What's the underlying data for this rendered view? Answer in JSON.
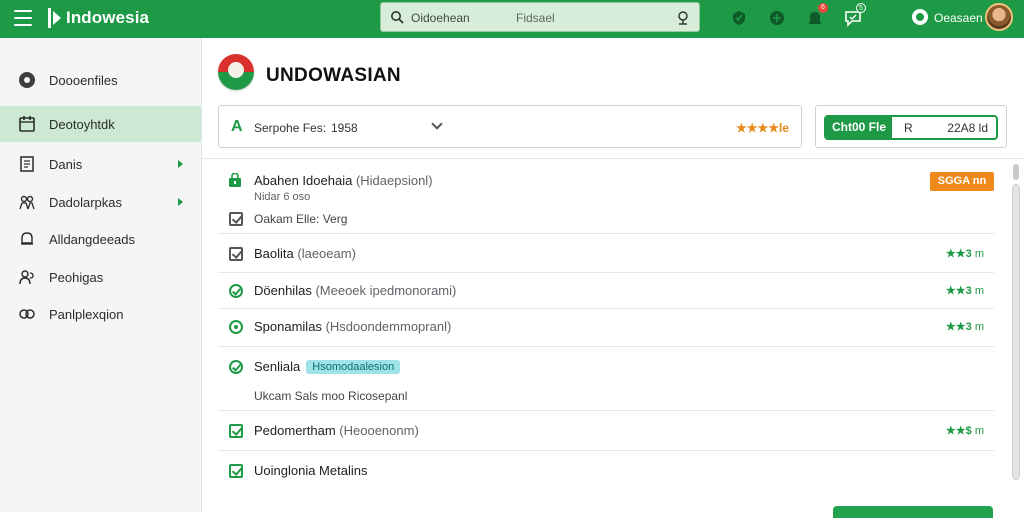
{
  "app": {
    "title": "Indowesia",
    "brand_color": "#1e9a46"
  },
  "topbar": {
    "search_placeholder": "Oidoehean",
    "search_scope": "Fidsael",
    "icons": [
      "menu-icon",
      "search-icon",
      "mic-icon",
      "shield-icon",
      "chat-icon",
      "bell-icon",
      "message-icon"
    ],
    "badges": {
      "bell": "6",
      "message": "5"
    },
    "user_name": "Oeasaen"
  },
  "sidebar": {
    "items": [
      {
        "label": "Doooenfiles",
        "icon": "record-icon",
        "active": false,
        "has_arrow": false
      },
      {
        "label": "Deotoyhtdk",
        "icon": "calendar-icon",
        "active": true,
        "has_arrow": false
      },
      {
        "label": "Danis",
        "icon": "document-icon",
        "active": false,
        "has_arrow": true
      },
      {
        "label": "Dadolarpkas",
        "icon": "users-icon",
        "active": false,
        "has_arrow": true
      },
      {
        "label": "Alldangdeeads",
        "icon": "bell-outline-icon",
        "active": false,
        "has_arrow": false
      },
      {
        "label": "Peohigas",
        "icon": "people-icon",
        "active": false,
        "has_arrow": false
      },
      {
        "label": "Panlplexqion",
        "icon": "link-icon",
        "active": false,
        "has_arrow": false
      }
    ]
  },
  "main": {
    "title": "UNDOWASIAN",
    "filter": {
      "label": "Serpohe Fes:",
      "value": "1958",
      "rating": "★★★★le"
    },
    "side_box": {
      "button_label": "Cht00 Fle",
      "mid": "R",
      "right": "22A8 ld"
    },
    "rows": [
      {
        "title": "Abahen Idoehaia",
        "paren": "(Hidaepsionl)",
        "sub": "Nidar 6 oso",
        "note": "Oakam Elle: Verg",
        "badge": "SGGA nn",
        "rating": ""
      },
      {
        "title": "Baolita",
        "paren": "(laeoeam)",
        "rating": "★★3",
        "unit": "m"
      },
      {
        "title": "Döenhilas",
        "paren": "(Meeoek ipedmonorami)",
        "rating": "★★3",
        "unit": "m"
      },
      {
        "title": "Sponamilas",
        "paren": "(Hsdoondemmopranl)",
        "rating": "★★3",
        "unit": "m"
      },
      {
        "title": "Senliala",
        "tag": "Hsomodaalesion",
        "note": "Ukcam Sals moo Ricosepanl",
        "rating": ""
      },
      {
        "title": "Pedomertham",
        "paren": "(Heooenonm)",
        "rating": "★★$",
        "unit": "m"
      },
      {
        "title": "Uoinglonia Metalins",
        "rating": ""
      }
    ]
  }
}
